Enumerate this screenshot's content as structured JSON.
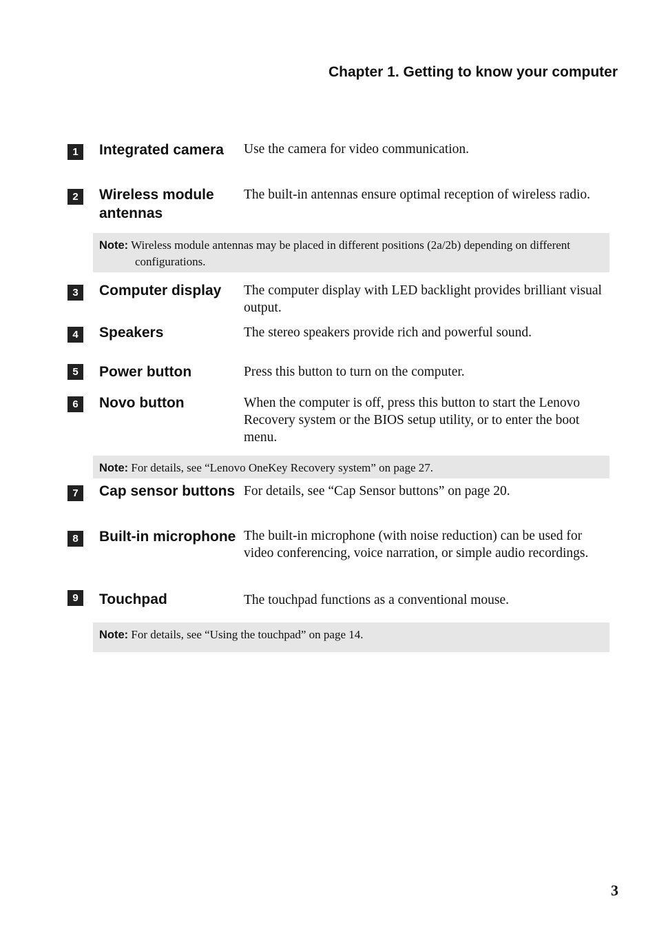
{
  "header": {
    "chapter_title": "Chapter 1. Getting to know your computer"
  },
  "items": [
    {
      "number": "1",
      "term": "Integrated camera",
      "description": "Use the camera for video communication."
    },
    {
      "number": "2",
      "term": "Wireless module antennas",
      "description": "The built-in antennas ensure optimal reception of wireless radio."
    },
    {
      "number": "3",
      "term": "Computer display",
      "description": "The computer display with LED backlight provides brilliant visual output."
    },
    {
      "number": "4",
      "term": "Speakers",
      "description": "The stereo speakers provide rich and powerful sound."
    },
    {
      "number": "5",
      "term": "Power button",
      "description": "Press this button to turn on the computer."
    },
    {
      "number": "6",
      "term": "Novo button",
      "description": "When the computer is off, press this button to start the Lenovo Recovery system or the BIOS setup utility, or to enter the boot menu."
    },
    {
      "number": "7",
      "term": "Cap sensor buttons",
      "description": "For details, see “Cap Sensor buttons” on page 20."
    },
    {
      "number": "8",
      "term": "Built-in microphone",
      "description": "The built-in microphone (with noise reduction) can be used for video conferencing, voice narration, or simple audio recordings."
    },
    {
      "number": "9",
      "term": "Touchpad",
      "description": "The touchpad functions as a conventional mouse."
    }
  ],
  "notes": [
    {
      "label": "Note:",
      "text": "Wireless module antennas may be placed in different positions (2a/2b) depending on different configurations."
    },
    {
      "label": "Note:",
      "text": "For details, see “Lenovo OneKey Recovery system” on page 27."
    },
    {
      "label": "Note:",
      "text": "For details, see “Using the touchpad” on page 14."
    }
  ],
  "footer": {
    "page_number": "3"
  }
}
